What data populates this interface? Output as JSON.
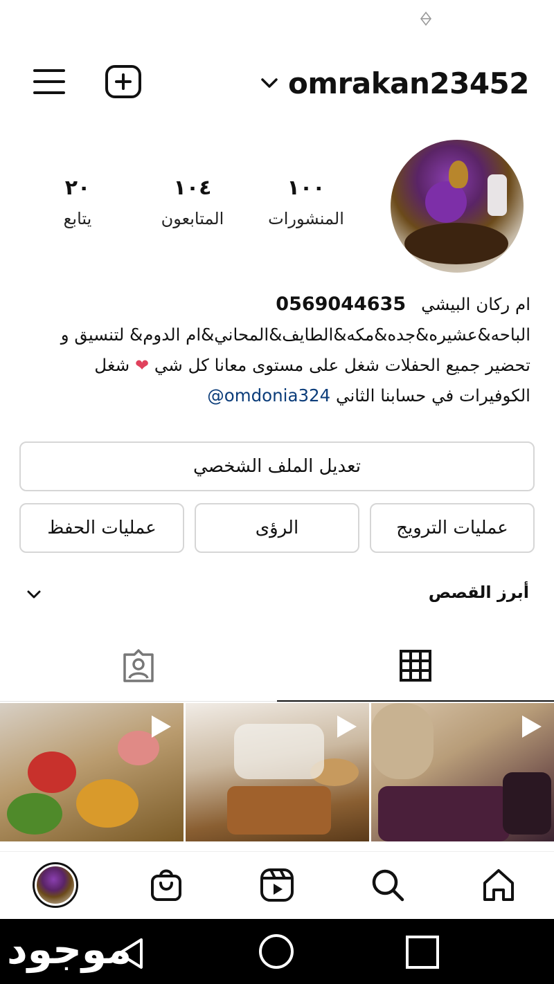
{
  "header": {
    "username": "omrakan23452"
  },
  "profile": {
    "stats": [
      {
        "value": "١٠٠",
        "label": "المنشورات"
      },
      {
        "value": "١٠٤",
        "label": "المتابعون"
      },
      {
        "value": "٢٠",
        "label": "يتابع"
      }
    ],
    "bio": {
      "name": "ام ركان البيشي",
      "phone": "0569044635",
      "line1": "الباحه&عشيره&جده&مكه&الطايف&المحاني&ام الدوم& لتنسيق و",
      "line2": "تحضير جميع الحفلات شغل على مستوى معانا كل شي",
      "line2_end": "شغل",
      "line3": "الكوفيرات في حسابنا الثاني",
      "link": "@omdonia324"
    }
  },
  "buttons": {
    "edit_profile": "تعديل الملف الشخصي",
    "promotions": "عمليات الترويج",
    "insights": "الرؤى",
    "saved": "عمليات الحفظ"
  },
  "highlights": {
    "title": "أبرز القصص"
  },
  "tabs": {
    "active": "grid"
  },
  "watermark": "موجود",
  "colors": {
    "link": "#0c3d7a",
    "heart": "#e0415c",
    "border": "#d6d6d6"
  }
}
